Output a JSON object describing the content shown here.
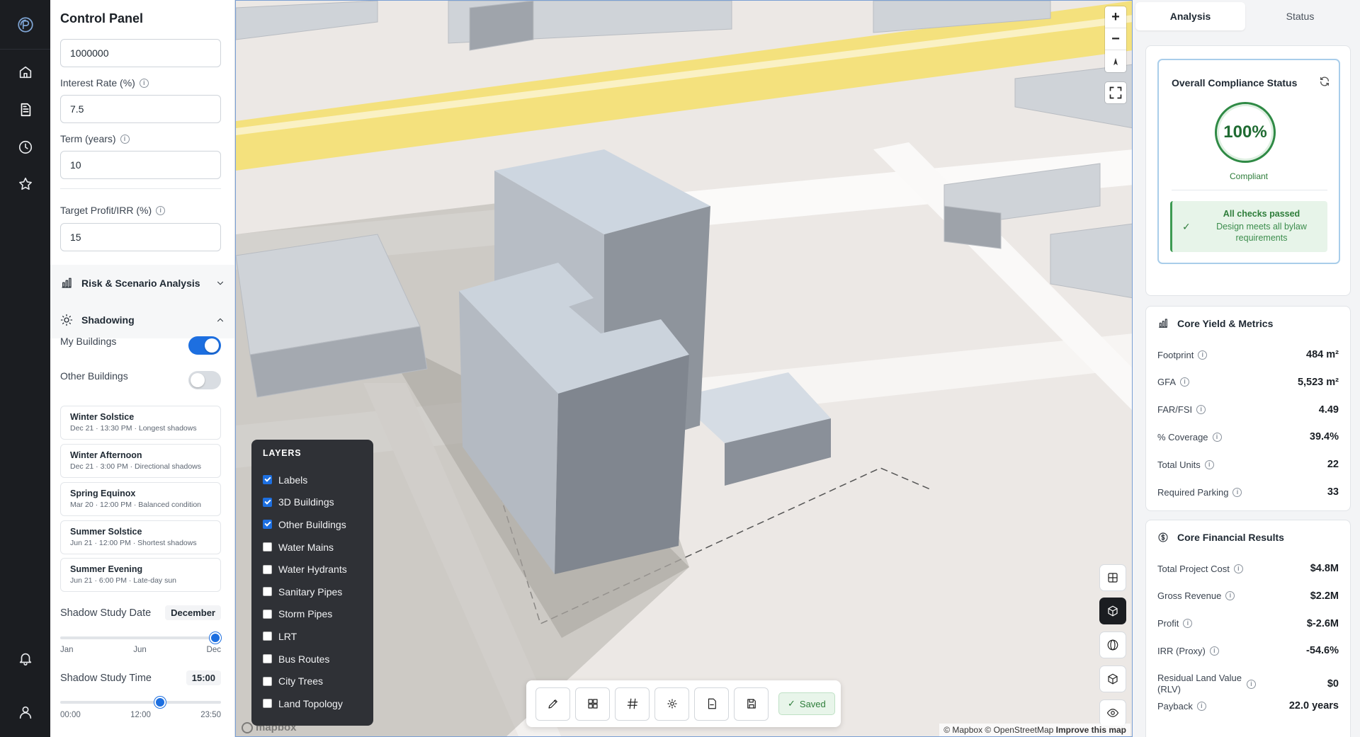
{
  "control_panel": {
    "title": "Control Panel",
    "loan_amount_value": "1000000",
    "interest_rate": {
      "label": "Interest Rate (%)",
      "value": "7.5"
    },
    "term": {
      "label": "Term (years)",
      "value": "10"
    },
    "target_profit": {
      "label": "Target Profit/IRR (%)",
      "value": "15"
    },
    "risk_section": {
      "label": "Risk & Scenario Analysis",
      "expanded": false
    },
    "shadowing_section": {
      "label": "Shadowing",
      "expanded": true
    },
    "my_buildings": {
      "label": "My Buildings",
      "on": true
    },
    "other_buildings": {
      "label": "Other Buildings",
      "on": false
    },
    "presets": [
      {
        "name": "Winter Solstice",
        "detail": "Dec 21 · 13:30 PM · Longest shadows"
      },
      {
        "name": "Winter Afternoon",
        "detail": "Dec 21 · 3:00 PM · Directional shadows"
      },
      {
        "name": "Spring Equinox",
        "detail": "Mar 20 · 12:00 PM · Balanced condition"
      },
      {
        "name": "Summer Solstice",
        "detail": "Jun 21 · 12:00 PM · Shortest shadows"
      },
      {
        "name": "Summer Evening",
        "detail": "Jun 21 · 6:00 PM · Late-day sun"
      }
    ],
    "shadow_date": {
      "label": "Shadow Study Date",
      "value": "December",
      "ticks": [
        "Jan",
        "Jun",
        "Dec"
      ],
      "position": 1.0
    },
    "shadow_time": {
      "label": "Shadow Study Time",
      "value": "15:00",
      "ticks": [
        "00:00",
        "12:00",
        "23:50"
      ],
      "position": 0.63
    }
  },
  "map": {
    "layers_title": "LAYERS",
    "layers": [
      {
        "label": "Labels",
        "checked": true
      },
      {
        "label": "3D Buildings",
        "checked": true
      },
      {
        "label": "Other Buildings",
        "checked": true
      },
      {
        "label": "Water Mains",
        "checked": false
      },
      {
        "label": "Water Hydrants",
        "checked": false
      },
      {
        "label": "Sanitary Pipes",
        "checked": false
      },
      {
        "label": "Storm Pipes",
        "checked": false
      },
      {
        "label": "LRT",
        "checked": false
      },
      {
        "label": "Bus Routes",
        "checked": false
      },
      {
        "label": "City Trees",
        "checked": false
      },
      {
        "label": "Land Topology",
        "checked": false
      }
    ],
    "zoom_in": "+",
    "zoom_out": "−",
    "saved_label": "Saved",
    "logo_text": "mapbox",
    "attribution": "© Mapbox © OpenStreetMap",
    "improve_link": "Improve this map"
  },
  "right_panel": {
    "tabs": [
      {
        "label": "Analysis",
        "active": true
      },
      {
        "label": "Status",
        "active": false
      }
    ],
    "compliance": {
      "title": "Overall Compliance Status",
      "percent": "100%",
      "status": "Compliant",
      "passed_title": "All checks passed",
      "passed_detail": "Design meets all bylaw requirements"
    },
    "yield": {
      "title": "Core Yield & Metrics",
      "rows": [
        {
          "label": "Footprint",
          "value": "484 m²"
        },
        {
          "label": "GFA",
          "value": "5,523 m²"
        },
        {
          "label": "FAR/FSI",
          "value": "4.49"
        },
        {
          "label": "% Coverage",
          "value": "39.4%"
        },
        {
          "label": "Total Units",
          "value": "22"
        },
        {
          "label": "Required Parking",
          "value": "33"
        }
      ]
    },
    "financial": {
      "title": "Core Financial Results",
      "rows": [
        {
          "label": "Total Project Cost",
          "value": "$4.8M"
        },
        {
          "label": "Gross Revenue",
          "value": "$2.2M"
        },
        {
          "label": "Profit",
          "value": "$-2.6M"
        },
        {
          "label": "IRR (Proxy)",
          "value": "-54.6%"
        },
        {
          "label": "Residual Land Value (RLV)",
          "value": "$0"
        },
        {
          "label": "Payback",
          "value": "22.0 years"
        }
      ]
    }
  },
  "colors": {
    "accent": "#1d6fe0",
    "success": "#2e7d3a",
    "rail": "#1b1d21"
  }
}
